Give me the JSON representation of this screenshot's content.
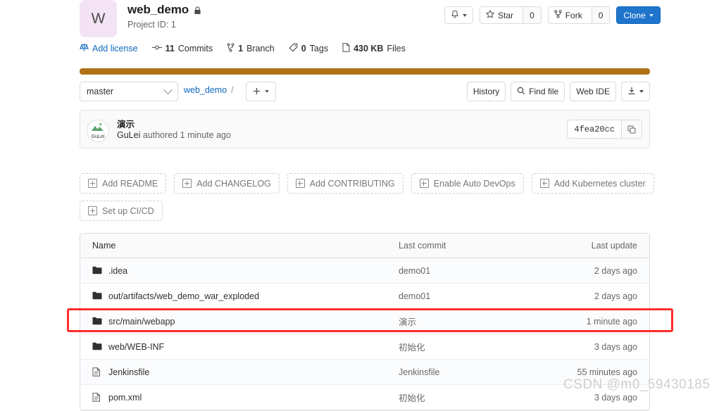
{
  "project": {
    "avatar_letter": "W",
    "name": "web_demo",
    "visibility_icon": "lock-icon",
    "project_id_label": "Project ID: 1"
  },
  "header_actions": {
    "notification_icon": "bell-icon",
    "star_label": "Star",
    "star_count": "0",
    "fork_label": "Fork",
    "fork_count": "0",
    "clone_label": "Clone"
  },
  "stats": [
    {
      "icon": "scale-icon",
      "bold": "",
      "text": "Add license",
      "link": true
    },
    {
      "icon": "commit-icon",
      "bold": "11",
      "text": "Commits",
      "link": false
    },
    {
      "icon": "branch-icon",
      "bold": "1",
      "text": "Branch",
      "link": false
    },
    {
      "icon": "tag-icon",
      "bold": "0",
      "text": "Tags",
      "link": false
    },
    {
      "icon": "file-icon",
      "bold": "430 KB",
      "text": "Files",
      "link": false
    }
  ],
  "language_bar": {
    "color": "#b07219",
    "percent": 100
  },
  "toolbar": {
    "branch": "master",
    "breadcrumb_root": "web_demo",
    "breadcrumb_separator": "/",
    "add_icon": "plus-icon",
    "history_label": "History",
    "find_file_label": "Find file",
    "find_file_icon": "search-icon",
    "web_ide_label": "Web IDE",
    "download_icon": "download-icon"
  },
  "last_commit": {
    "avatar_name": "GuLei",
    "message": "演示",
    "author": "GuLei",
    "authored_text": "authored 1 minute ago",
    "short_sha": "4fea20cc",
    "copy_icon": "copy-icon"
  },
  "setup_buttons": [
    {
      "label": "Add README"
    },
    {
      "label": "Add CHANGELOG"
    },
    {
      "label": "Add CONTRIBUTING"
    },
    {
      "label": "Enable Auto DevOps"
    },
    {
      "label": "Add Kubernetes cluster"
    },
    {
      "label": "Set up CI/CD"
    }
  ],
  "file_table": {
    "columns": {
      "name": "Name",
      "last_commit": "Last commit",
      "last_update": "Last update"
    },
    "rows": [
      {
        "icon": "folder-icon",
        "name": ".idea",
        "commit": "demo01",
        "update": "2 days ago"
      },
      {
        "icon": "folder-icon",
        "name": "out/artifacts/web_demo_war_exploded",
        "commit": "demo01",
        "update": "2 days ago"
      },
      {
        "icon": "folder-icon",
        "name": "src/main/webapp",
        "commit": "演示",
        "update": "1 minute ago"
      },
      {
        "icon": "folder-icon",
        "name": "web/WEB-INF",
        "commit": "初始化",
        "update": "3 days ago"
      },
      {
        "icon": "document-icon",
        "name": "Jenkinsfile",
        "commit": "Jenkinsfile",
        "update": "55 minutes ago"
      },
      {
        "icon": "document-icon",
        "name": "pom.xml",
        "commit": "初始化",
        "update": "3 days ago"
      }
    ]
  },
  "annotation": {
    "color": "#ff2d2d",
    "target_row": "src/main/webapp"
  },
  "watermark": "CSDN @m0_59430185"
}
